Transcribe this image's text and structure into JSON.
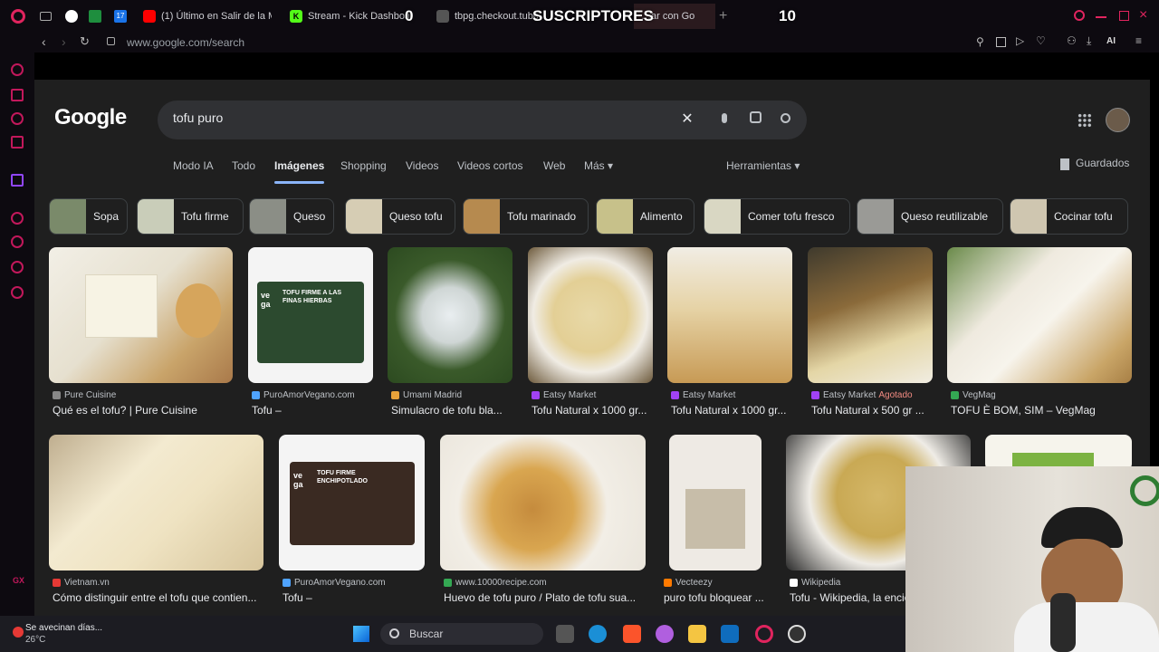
{
  "browser": {
    "tabs": [
      {
        "label": "(1) Último en Salir de la Me",
        "color": "#ff0000"
      },
      {
        "label": "Stream - Kick Dashboard",
        "color": "#53fc18"
      },
      {
        "label": "tbpg.checkout.tubo",
        "color": "#555555"
      },
      {
        "label": "…ar con Go",
        "color": "#555555"
      }
    ],
    "url": "www.google.com/search"
  },
  "overlay": {
    "count_left": "0",
    "title": "SUSCRIPTORES",
    "count_right": "10"
  },
  "google": {
    "logo": "Google",
    "query": "tofu puro",
    "nav": [
      "Modo IA",
      "Todo",
      "Imágenes",
      "Shopping",
      "Videos",
      "Videos cortos",
      "Web",
      "Más ▾"
    ],
    "tools": "Herramientas ▾",
    "saved": "Guardados",
    "chips": [
      "Sopa",
      "Tofu firme",
      "Queso",
      "Queso tofu",
      "Tofu marinado",
      "Alimento",
      "Comer tofu fresco",
      "Queso reutilizable",
      "Cocinar tofu"
    ],
    "row1": [
      {
        "source": "Pure Cuisine",
        "title": "Qué es el tofu? | Pure Cuisine"
      },
      {
        "source": "PuroAmorVegano.com",
        "title": "Tofu –"
      },
      {
        "source": "Umami Madrid",
        "title": "Simulacro de tofu bla..."
      },
      {
        "source": "Eatsy Market",
        "title": "Tofu Natural x 1000 gr..."
      },
      {
        "source": "Eatsy Market",
        "title": "Tofu Natural x 1000 gr..."
      },
      {
        "source": "Eatsy Market",
        "badge": "Agotado",
        "title": "Tofu Natural x 500 gr ..."
      },
      {
        "source": "VegMag",
        "title": "TOFU È BOM, SIM – VegMag"
      }
    ],
    "row2": [
      {
        "source": "Vietnam.vn",
        "title": "Cómo distinguir entre el tofu que contien..."
      },
      {
        "source": "PuroAmorVegano.com",
        "title": "Tofu –"
      },
      {
        "source": "www.10000recipe.com",
        "title": "Huevo de tofu puro / Plato de tofu sua..."
      },
      {
        "source": "Vecteezy",
        "title": "puro tofu bloquear ..."
      },
      {
        "source": "Wikipedia",
        "title": "Tofu - Wikipedia, la encic"
      }
    ],
    "pack_text": "TOFU FIRME A LAS FINAS HIERBAS",
    "pack_text2": "TOFU FIRME ENCHIPOTLADO",
    "pack_brand": "ve ga"
  },
  "taskbar": {
    "weather_title": "Se avecinan días...",
    "weather_temp": "26°C",
    "search_placeholder": "Buscar"
  }
}
